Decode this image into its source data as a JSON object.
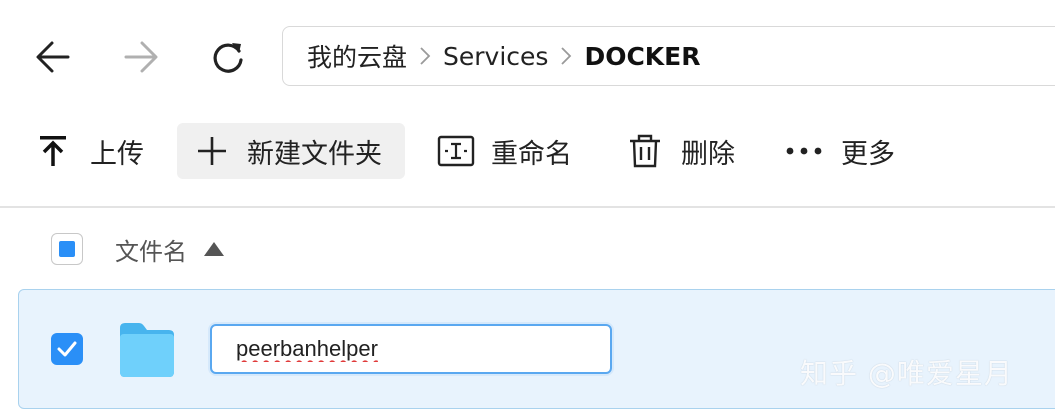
{
  "nav": {
    "back_icon": "arrow-left-icon",
    "forward_icon": "arrow-right-icon",
    "refresh_icon": "refresh-icon"
  },
  "breadcrumb": {
    "items": [
      "我的云盘",
      "Services",
      "DOCKER"
    ],
    "separator_icon": "chevron-right-icon"
  },
  "toolbar": {
    "upload": "上传",
    "new_folder": "新建文件夹",
    "rename": "重命名",
    "delete": "删除",
    "more": "更多"
  },
  "list": {
    "column_name": "文件名",
    "sort_icon": "triangle-up-icon",
    "rows": [
      {
        "type_icon": "folder-icon",
        "name_value": "peerbanhelper",
        "selected": true
      }
    ]
  },
  "watermark": "知乎 @唯爱星月",
  "colors": {
    "accent": "#2a8ff7",
    "row_selected_bg": "#e8f3fd",
    "folder": "#5cc4f5"
  }
}
